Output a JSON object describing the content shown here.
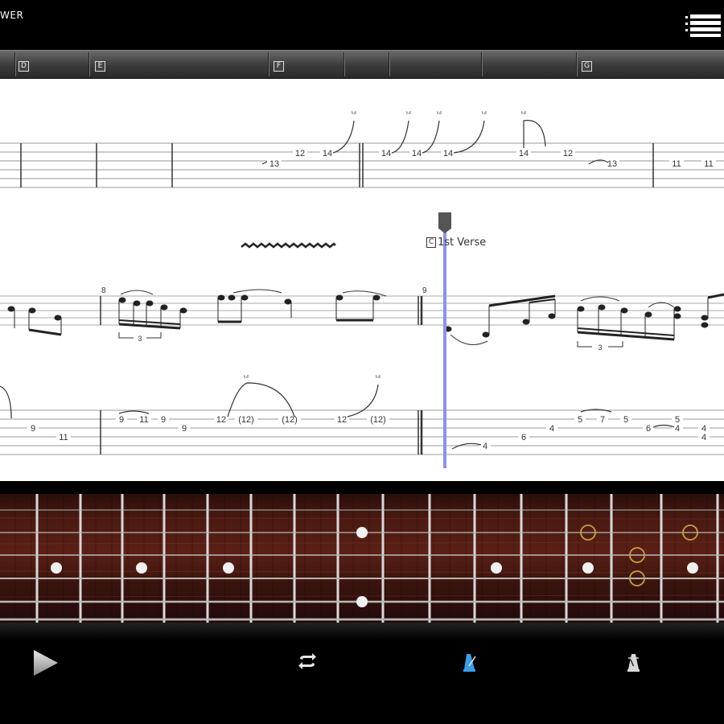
{
  "app": {
    "title_fragment": "WER"
  },
  "header": {
    "menu_icon": "hamburger-menu-icon"
  },
  "sections": [
    {
      "label": "D"
    },
    {
      "label": "E"
    },
    {
      "label": "F"
    },
    {
      "label": "G"
    }
  ],
  "score": {
    "section_label_box": "C",
    "section_label_text": "1st Verse",
    "measures": [
      {
        "number": "8"
      },
      {
        "number": "9"
      }
    ],
    "top_tab_frets": [
      "13",
      "12",
      "14",
      "14",
      "14",
      "14",
      "14",
      "12",
      "13",
      "11",
      "11"
    ],
    "bottom_tab_frets": [
      "9",
      "11",
      "9",
      "11",
      "9",
      "9",
      "12",
      "(12)",
      "(12)",
      "12",
      "(12)",
      "4",
      "6",
      "4",
      "5",
      "7",
      "5",
      "6",
      "5",
      "4",
      "4",
      "4"
    ],
    "bend_labels": [
      "full",
      "full",
      "full",
      "full",
      "full",
      "full",
      "full"
    ],
    "tuplet": "3"
  },
  "colors": {
    "playhead": "#8f8ff0",
    "fret_marker": "#f0f0f0",
    "target_ring": "#c8a040",
    "section_bar": "#3a3a3a"
  },
  "controls": {
    "play_icon": "play-icon",
    "loop_icon": "loop-icon",
    "metronome_icon": "metronome-icon",
    "count_in_icon": "count-in-metronome-icon"
  }
}
